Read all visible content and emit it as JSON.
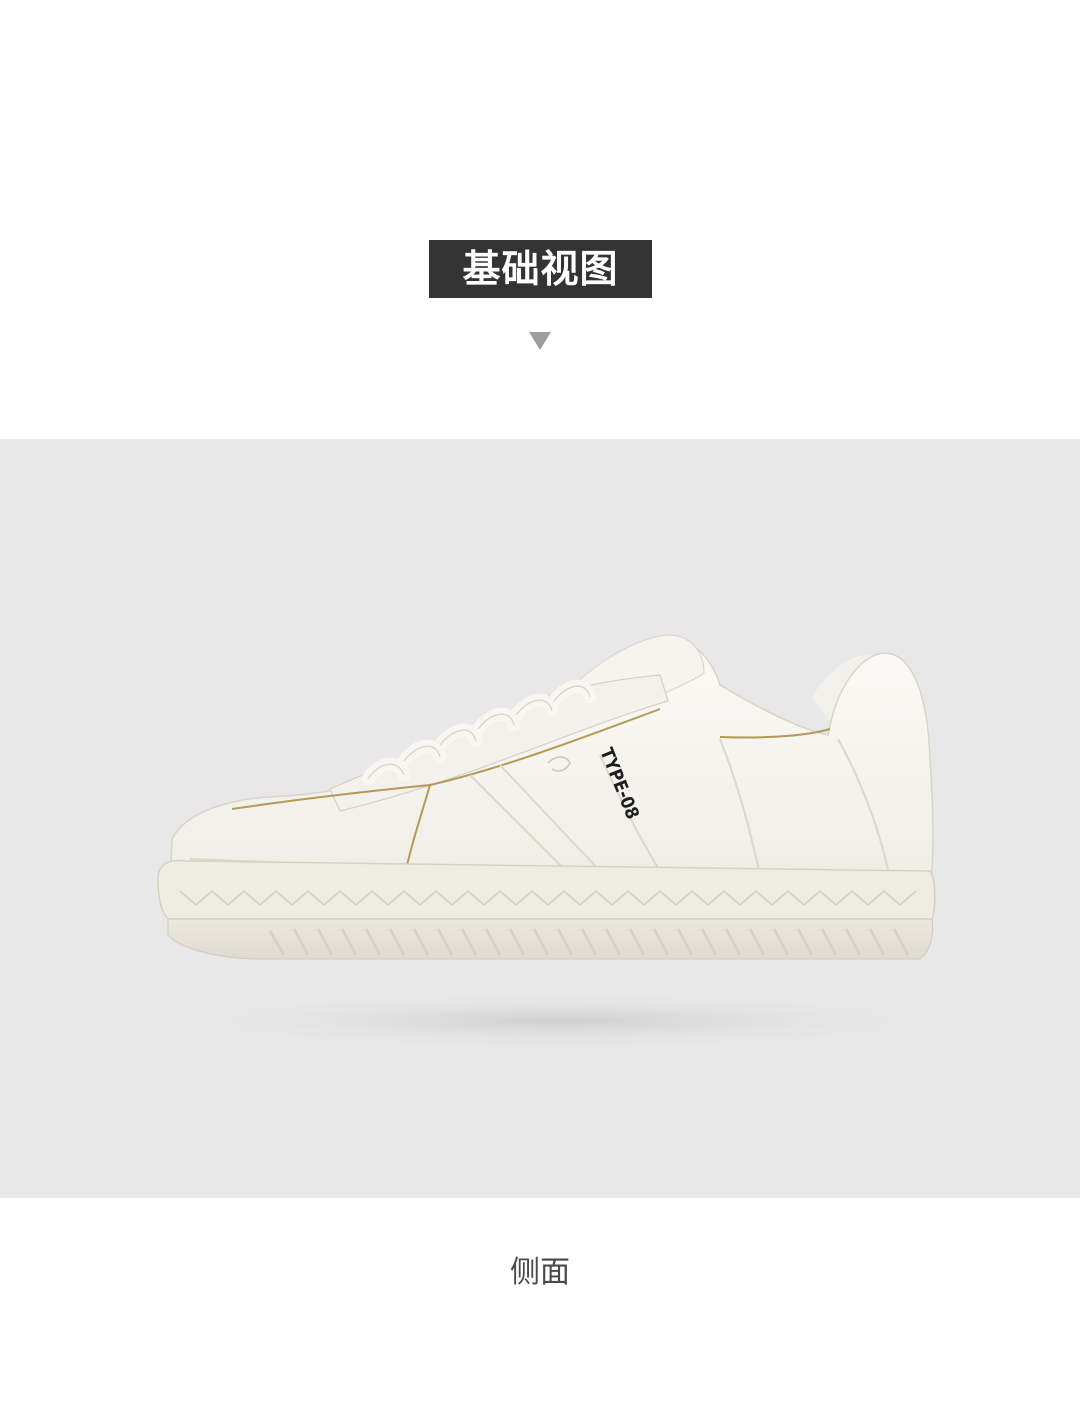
{
  "section": {
    "title": "基础视图",
    "caption": "侧面",
    "badge_color": "#333333",
    "caret_color": "#9e9e9e",
    "panel_color": "#e8e8e8"
  },
  "product": {
    "print_label": "TYPE-08",
    "icons": {
      "caret": "caret-down-icon",
      "photo": "sneaker-side-view"
    }
  }
}
